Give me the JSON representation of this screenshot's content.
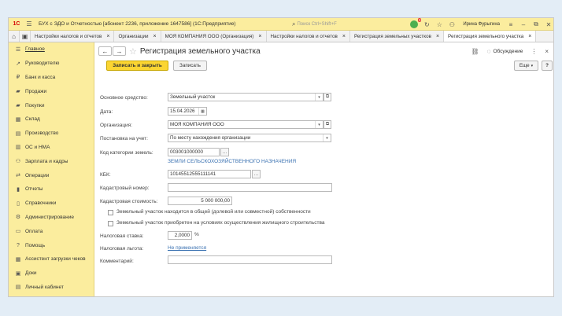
{
  "titlebar": {
    "logo": "1С",
    "title": "БУХ с ЭДО и Отчетностью [абонент 2236, приложение 1647586]  (1С:Предприятие)",
    "search_placeholder": "Поиск Ctrl+Shift+F",
    "notifications_count": "3",
    "user": "Ирина Фурыгина"
  },
  "tabs": [
    {
      "label": "Настройки налогов и отчетов"
    },
    {
      "label": "Организации"
    },
    {
      "label": "МОЯ КОМПАНИЯ ООО (Организация)"
    },
    {
      "label": "Настройки налогов и отчетов"
    },
    {
      "label": "Регистрация земельных участков"
    },
    {
      "label": "Регистрация земельного участка"
    }
  ],
  "sidebar": {
    "items": [
      {
        "label": "Главное",
        "icon": "menu-icon"
      },
      {
        "label": "Руководителю",
        "icon": "chart-line-icon"
      },
      {
        "label": "Банк и касса",
        "icon": "bank-icon"
      },
      {
        "label": "Продажи",
        "icon": "cart-sale-icon"
      },
      {
        "label": "Покупки",
        "icon": "cart-purchase-icon"
      },
      {
        "label": "Склад",
        "icon": "warehouse-icon"
      },
      {
        "label": "Производство",
        "icon": "factory-icon"
      },
      {
        "label": "ОС и НМА",
        "icon": "assets-icon"
      },
      {
        "label": "Зарплата и кадры",
        "icon": "people-icon"
      },
      {
        "label": "Операции",
        "icon": "operations-icon"
      },
      {
        "label": "Отчеты",
        "icon": "reports-icon"
      },
      {
        "label": "Справочники",
        "icon": "book-icon"
      },
      {
        "label": "Администрирование",
        "icon": "gear-icon"
      },
      {
        "label": "Оплата",
        "icon": "payment-icon"
      },
      {
        "label": "Помощь",
        "icon": "help-icon"
      },
      {
        "label": "Ассистент загрузки чеков",
        "icon": "receipt-icon"
      },
      {
        "label": "Доки",
        "icon": "docs-icon"
      },
      {
        "label": "Личный кабинет",
        "icon": "cabinet-icon"
      }
    ]
  },
  "form": {
    "title": "Регистрация земельного участка",
    "discussion": "Обсуждение",
    "save_close": "Записать и закрыть",
    "save": "Записать",
    "more": "Еще",
    "help": "?",
    "fields": {
      "asset_label": "Основное средство:",
      "asset_value": "Земельный участок",
      "date_label": "Дата:",
      "date_value": "15.04.2026",
      "org_label": "Организация:",
      "org_value": "МОЯ КОМПАНИЯ ООО",
      "registration_label": "Постановка на учет:",
      "registration_value": "По месту нахождения организации",
      "category_code_label": "Код категории земель:",
      "category_code_value": "003001000000",
      "category_name": "ЗЕМЛИ СЕЛЬСКОХОЗЯЙСТВЕННОГО НАЗНАЧЕНИЯ",
      "kbk_label": "КБК:",
      "kbk_value": "10145512555111141",
      "cadastral_number_label": "Кадастровый номер:",
      "cadastral_number_value": "",
      "cadastral_cost_label": "Кадастровая стоимость:",
      "cadastral_cost_value": "5 000 000,00",
      "shared_ownership": "Земельный участок находится в общей (долевой или совместной) собственности",
      "housing_construction": "Земельный участок приобретен на условиях осуществления жилищного строительства",
      "tax_rate_label": "Налоговая ставка:",
      "tax_rate_value": "2,0000",
      "tax_rate_unit": "%",
      "tax_benefit_label": "Налоговая льгота:",
      "tax_benefit_value": "Не применяется",
      "comment_label": "Комментарий:",
      "comment_value": ""
    }
  }
}
